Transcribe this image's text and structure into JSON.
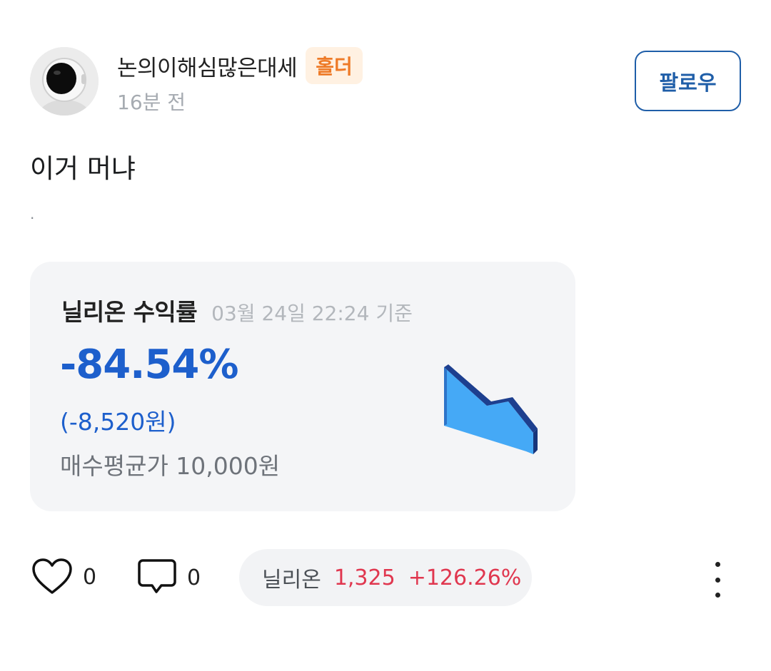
{
  "author": {
    "name": "논의이해심많은대세",
    "badge": "홀더",
    "time": "16분 전"
  },
  "follow_label": "팔로우",
  "post": {
    "title": "이거 머냐",
    "body": "."
  },
  "card": {
    "title": "닐리온 수익률",
    "date": "03월 24일 22:24 기준",
    "return_rate": "-84.54%",
    "return_amount": "(-8,520원)",
    "avg_price": "매수평균가 10,000원",
    "graphic_icon": "falling-chart-icon"
  },
  "actions": {
    "like_count": "0",
    "comment_count": "0",
    "stock": {
      "name": "닐리온",
      "price": "1,325",
      "change": "+126.26%"
    }
  },
  "colors": {
    "accent_blue": "#1d5fcc",
    "up_red": "#e0374f",
    "badge_orange": "#ee7a27"
  }
}
